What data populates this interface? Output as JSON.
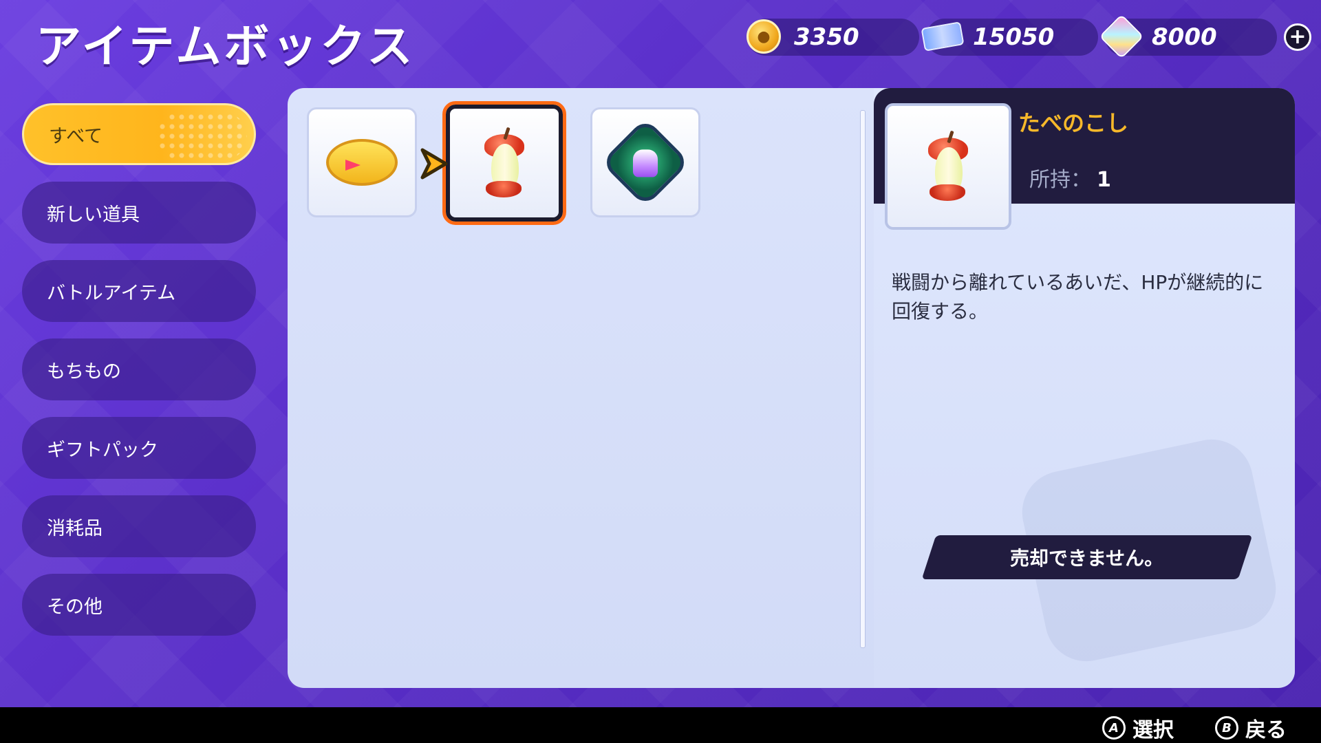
{
  "header": {
    "title": "アイテムボックス"
  },
  "currencies": [
    {
      "icon": "aeos-coin-icon",
      "value": "3350"
    },
    {
      "icon": "aeos-ticket-icon",
      "value": "15050"
    },
    {
      "icon": "aeos-gem-icon",
      "value": "8000"
    }
  ],
  "categories": [
    {
      "label": "すべて",
      "active": true
    },
    {
      "label": "新しい道具",
      "active": false
    },
    {
      "label": "バトルアイテム",
      "active": false
    },
    {
      "label": "もちもの",
      "active": false
    },
    {
      "label": "ギフトパック",
      "active": false
    },
    {
      "label": "消耗品",
      "active": false
    },
    {
      "label": "その他",
      "active": false
    }
  ],
  "items": [
    {
      "icon": "ring-item-icon",
      "selected": false
    },
    {
      "icon": "apple-core-icon",
      "selected": true
    },
    {
      "icon": "emblem-item-icon",
      "selected": false
    }
  ],
  "detail": {
    "name": "たべのこし",
    "owned_label": "所持：",
    "owned_count": "1",
    "description": "戦闘から離れているあいだ、HPが継続的に回復する。",
    "sell_label": "売却できません。"
  },
  "footer": {
    "a_glyph": "A",
    "a_label": "選択",
    "b_glyph": "B",
    "b_label": "戻る"
  },
  "colors": {
    "accent": "#ffb51c",
    "selection_outline": "#ff6a14",
    "item_name": "#f6b82a"
  }
}
